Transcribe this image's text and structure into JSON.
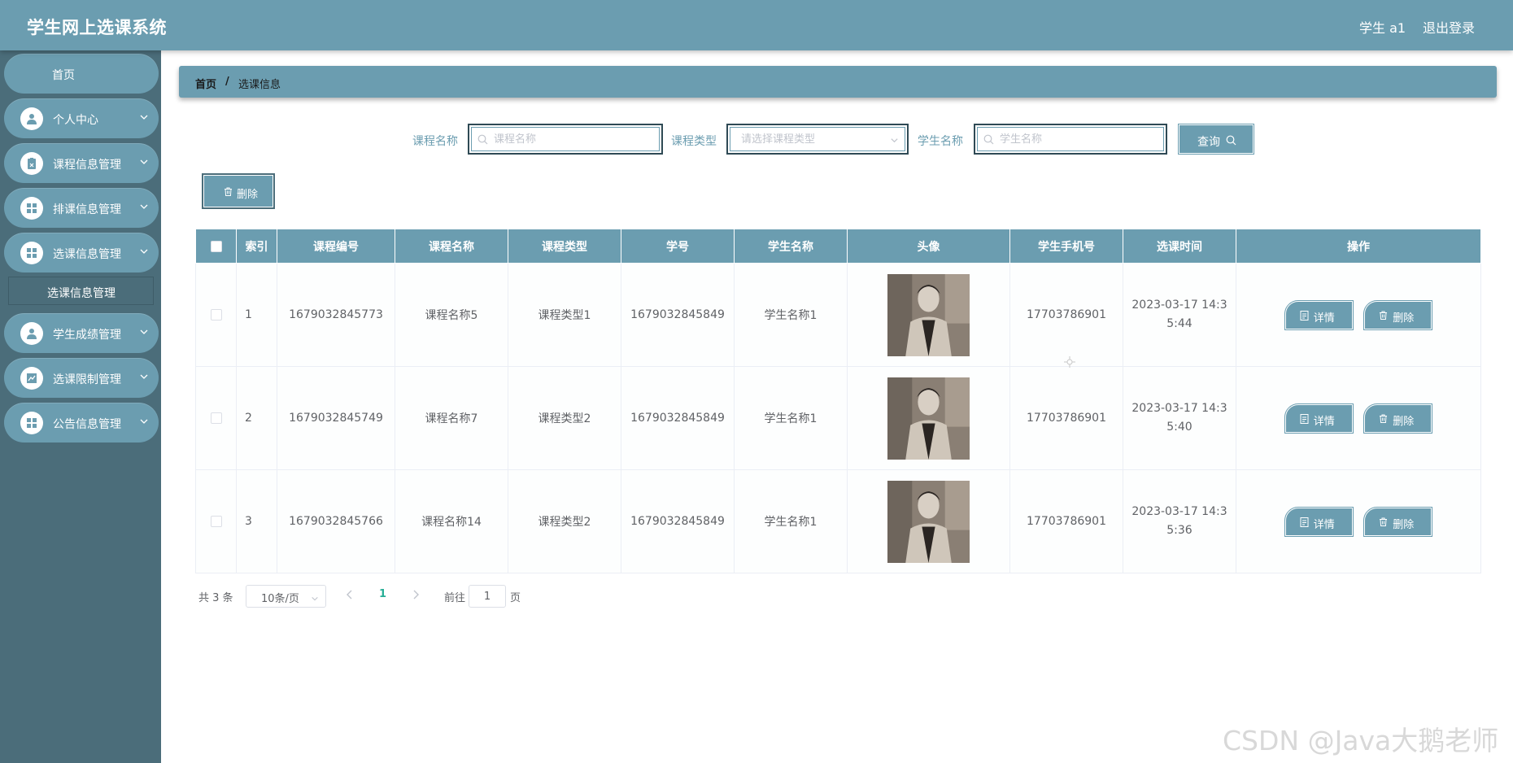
{
  "app": {
    "title": "学生网上选课系统",
    "user_label": "学生 a1",
    "logout_label": "退出登录"
  },
  "sidebar": {
    "items": [
      {
        "label": "首页",
        "icon": "home"
      },
      {
        "label": "个人中心",
        "icon": "user-icon"
      },
      {
        "label": "课程信息管理",
        "icon": "clipboard-icon"
      },
      {
        "label": "排课信息管理",
        "icon": "grid-icon"
      },
      {
        "label": "选课信息管理",
        "icon": "grid-icon"
      },
      {
        "label": "学生成绩管理",
        "icon": "user-icon"
      },
      {
        "label": "选课限制管理",
        "icon": "chart-icon"
      },
      {
        "label": "公告信息管理",
        "icon": "grid-icon"
      }
    ],
    "submenu": {
      "label": "选课信息管理"
    }
  },
  "breadcrumb": {
    "home": "首页",
    "separator": "/",
    "current": "选课信息"
  },
  "search": {
    "course_name_label": "课程名称",
    "course_name_placeholder": "课程名称",
    "course_type_label": "课程类型",
    "course_type_placeholder": "请选择课程类型",
    "student_name_label": "学生名称",
    "student_name_placeholder": "学生名称",
    "query_label": "查询"
  },
  "toolbar": {
    "delete_label": "删除"
  },
  "table": {
    "headers": [
      "",
      "索引",
      "课程编号",
      "课程名称",
      "课程类型",
      "学号",
      "学生名称",
      "头像",
      "学生手机号",
      "选课时间",
      "操作"
    ],
    "rows": [
      {
        "index": "1",
        "course_no": "1679032845773",
        "course_name": "课程名称5",
        "course_type": "课程类型1",
        "student_no": "1679032845849",
        "student_name": "学生名称1",
        "phone": "17703786901",
        "time_a": "2023-03-17 14:3",
        "time_b": "5:44"
      },
      {
        "index": "2",
        "course_no": "1679032845749",
        "course_name": "课程名称7",
        "course_type": "课程类型2",
        "student_no": "1679032845849",
        "student_name": "学生名称1",
        "phone": "17703786901",
        "time_a": "2023-03-17 14:3",
        "time_b": "5:40"
      },
      {
        "index": "3",
        "course_no": "1679032845766",
        "course_name": "课程名称14",
        "course_type": "课程类型2",
        "student_no": "1679032845849",
        "student_name": "学生名称1",
        "phone": "17703786901",
        "time_a": "2023-03-17 14:3",
        "time_b": "5:36"
      }
    ],
    "detail_label": "详情",
    "delete_label": "删除"
  },
  "pagination": {
    "total": "共 3 条",
    "page_size": "10条/页",
    "current_page": "1",
    "goto_label": "前往",
    "goto_value": "1",
    "page_suffix": "页"
  },
  "watermark": "CSDN @Java大鹅老师",
  "colors": {
    "primary": "#6b9db0",
    "sidebar_bg": "#4b6d7a",
    "active_page": "#27ae96"
  }
}
